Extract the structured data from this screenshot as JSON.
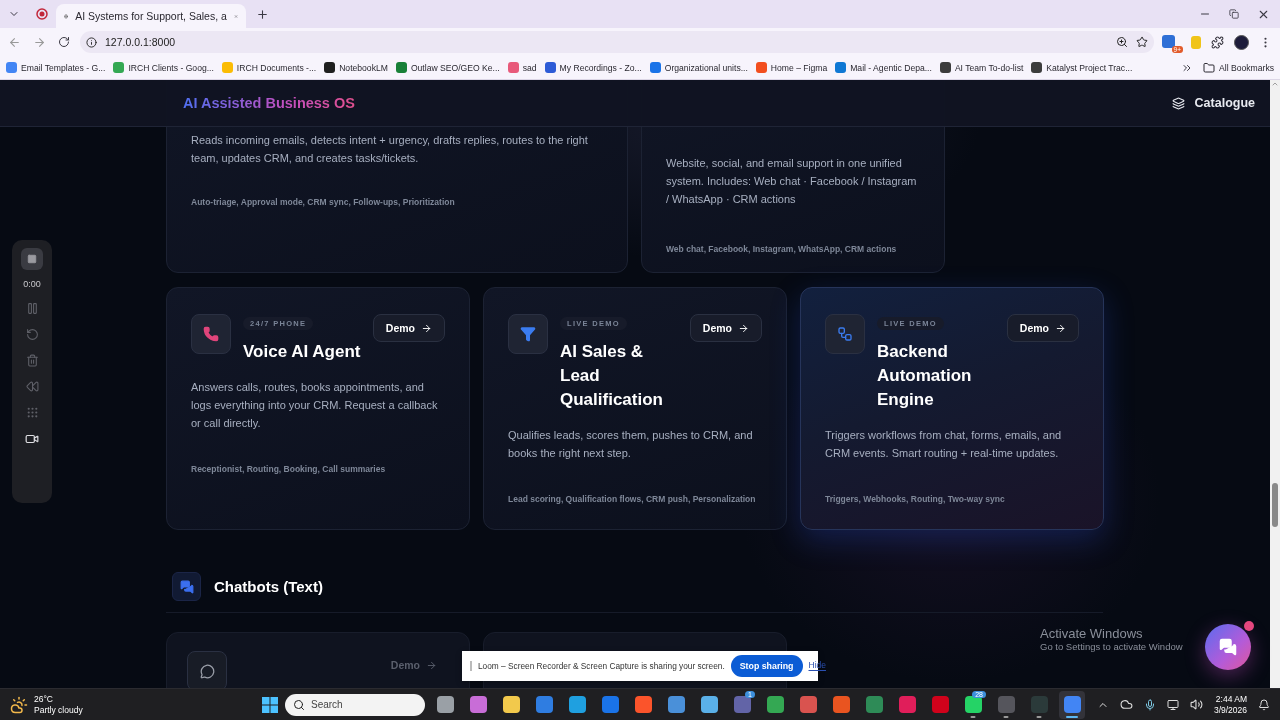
{
  "browser": {
    "tabs": [
      {
        "title": "AI Systems for Support, Sales, a",
        "selected": true
      }
    ],
    "address": "127.0.0.1:8000",
    "extension_badge": "9+",
    "bookmarks": [
      {
        "label": "Email Templates - G...",
        "color": "#4285f4"
      },
      {
        "label": "IRCH Clients - Goog...",
        "color": "#34a853"
      },
      {
        "label": "IRCH Documents -...",
        "color": "#fbbc04"
      },
      {
        "label": "NotebookLM",
        "color": "#1f1f1f"
      },
      {
        "label": "Outlaw SEO/GEO Ke...",
        "color": "#188038"
      },
      {
        "label": "sad",
        "color": "#e8597a"
      },
      {
        "label": "My Recordings - Zo...",
        "color": "#2d5bd6"
      },
      {
        "label": "Organizational units...",
        "color": "#1a73e8"
      },
      {
        "label": "Home – Figma",
        "color": "#f24e1e"
      },
      {
        "label": "Mail - Agentic Depa...",
        "color": "#0f78d4"
      },
      {
        "label": "AI Team To-do-list",
        "color": "#3c3c3c"
      },
      {
        "label": "Katalyst Project Trac...",
        "color": "#3c3c3c"
      }
    ],
    "all_bookmarks": "All Bookmarks"
  },
  "page": {
    "brand": "AI Assisted Business OS",
    "nav": "Catalogue",
    "top_cards": [
      {
        "description": "Reads incoming emails, detects intent + urgency, drafts replies, routes to the right team, updates CRM, and creates tasks/tickets.",
        "tags": "Auto-triage, Approval mode, CRM sync, Follow-ups, Prioritization"
      },
      {
        "description": "Website, social, and email support in one unified system. Includes: Web chat · Facebook / Instagram / WhatsApp · CRM actions",
        "tags": "Web chat, Facebook, Instagram, WhatsApp, CRM actions"
      }
    ],
    "cards": [
      {
        "kind": "phone",
        "badge": "24/7 PHONE",
        "title": "Voice AI Agent",
        "button": "Demo",
        "description": "Answers calls, routes, books appointments, and logs everything into your CRM. Request a callback or call directly.",
        "tags": "Receptionist, Routing, Booking, Call summaries",
        "hovered": false
      },
      {
        "kind": "funnel",
        "badge": "LIVE DEMO",
        "title": "AI Sales & Lead Qualification",
        "button": "Demo",
        "description": "Qualifies leads, scores them, pushes to CRM, and books the right next step.",
        "tags": "Lead scoring, Qualification flows, CRM push, Personalization",
        "hovered": false
      },
      {
        "kind": "flow",
        "badge": "LIVE DEMO",
        "title": "Backend Automation Engine",
        "button": "Demo",
        "description": "Triggers workflows from chat, forms, emails, and CRM events. Smart routing + real-time updates.",
        "tags": "Triggers, Webhooks, Routing, Two-way sync",
        "hovered": true
      }
    ],
    "section": {
      "title": "Chatbots (Text)"
    },
    "bottom_cards": [
      {
        "kind": "whatsapp",
        "button": "Demo"
      },
      {
        "kind": "blank"
      }
    ]
  },
  "recorder": {
    "time": "0:00"
  },
  "loom_banner": {
    "message": "Loom – Screen Recorder & Screen Capture is sharing your screen.",
    "stop": "Stop sharing",
    "hide": "Hide"
  },
  "activation": {
    "title": "Activate Windows",
    "hint": "Go to Settings to activate Window"
  },
  "taskbar": {
    "temperature": "26°C",
    "weather": "Partly cloudy",
    "search_placeholder": "Search",
    "apps": [
      {
        "running": false,
        "selected": false
      },
      {
        "running": false,
        "selected": false
      },
      {
        "running": false,
        "selected": false
      },
      {
        "running": false,
        "selected": false
      },
      {
        "running": false,
        "selected": false
      },
      {
        "running": false,
        "selected": false
      },
      {
        "running": false,
        "selected": false
      },
      {
        "running": false,
        "selected": false
      },
      {
        "running": false,
        "selected": false
      },
      {
        "running": false,
        "selected": false,
        "badge": "1"
      },
      {
        "running": false,
        "selected": false
      },
      {
        "running": false,
        "selected": false
      },
      {
        "running": false,
        "selected": false
      },
      {
        "running": false,
        "selected": false
      },
      {
        "running": false,
        "selected": false
      },
      {
        "running": false,
        "selected": false
      },
      {
        "running": true,
        "selected": false,
        "badge": "28"
      },
      {
        "running": true,
        "selected": false
      },
      {
        "running": true,
        "selected": false
      },
      {
        "running": true,
        "selected": true
      }
    ],
    "time": "2:44 AM",
    "date": "3/9/2026"
  }
}
